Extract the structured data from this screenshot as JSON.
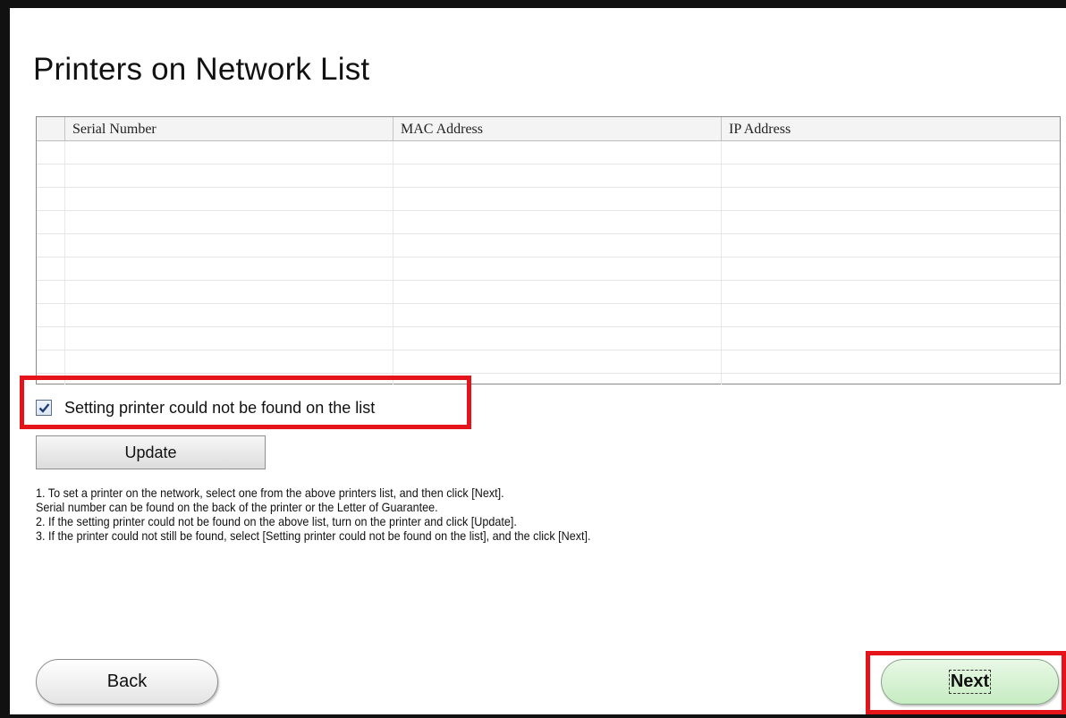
{
  "page": {
    "title": "Printers on Network List"
  },
  "printer_list": {
    "columns": [
      "Serial Number",
      "MAC Address",
      "IP Address"
    ],
    "rows": []
  },
  "not_found_checkbox": {
    "label": "Setting printer could not be found on the list",
    "checked": true
  },
  "update_button": {
    "label": "Update"
  },
  "instructions": [
    "1. To set a printer on the network, select one from the above printers list, and then click [Next].",
    "Serial number can be found on the back of the printer or the Letter of Guarantee.",
    "2. If the setting printer could not be found on the above list, turn on the printer and click [Update].",
    "3. If the printer could not still be found, select [Setting printer could not be found on the list], and the click [Next]."
  ],
  "footer": {
    "back_label": "Back",
    "next_label": "Next"
  },
  "colors": {
    "highlight": "#e5141b",
    "next_button": "#c6ecc2"
  }
}
